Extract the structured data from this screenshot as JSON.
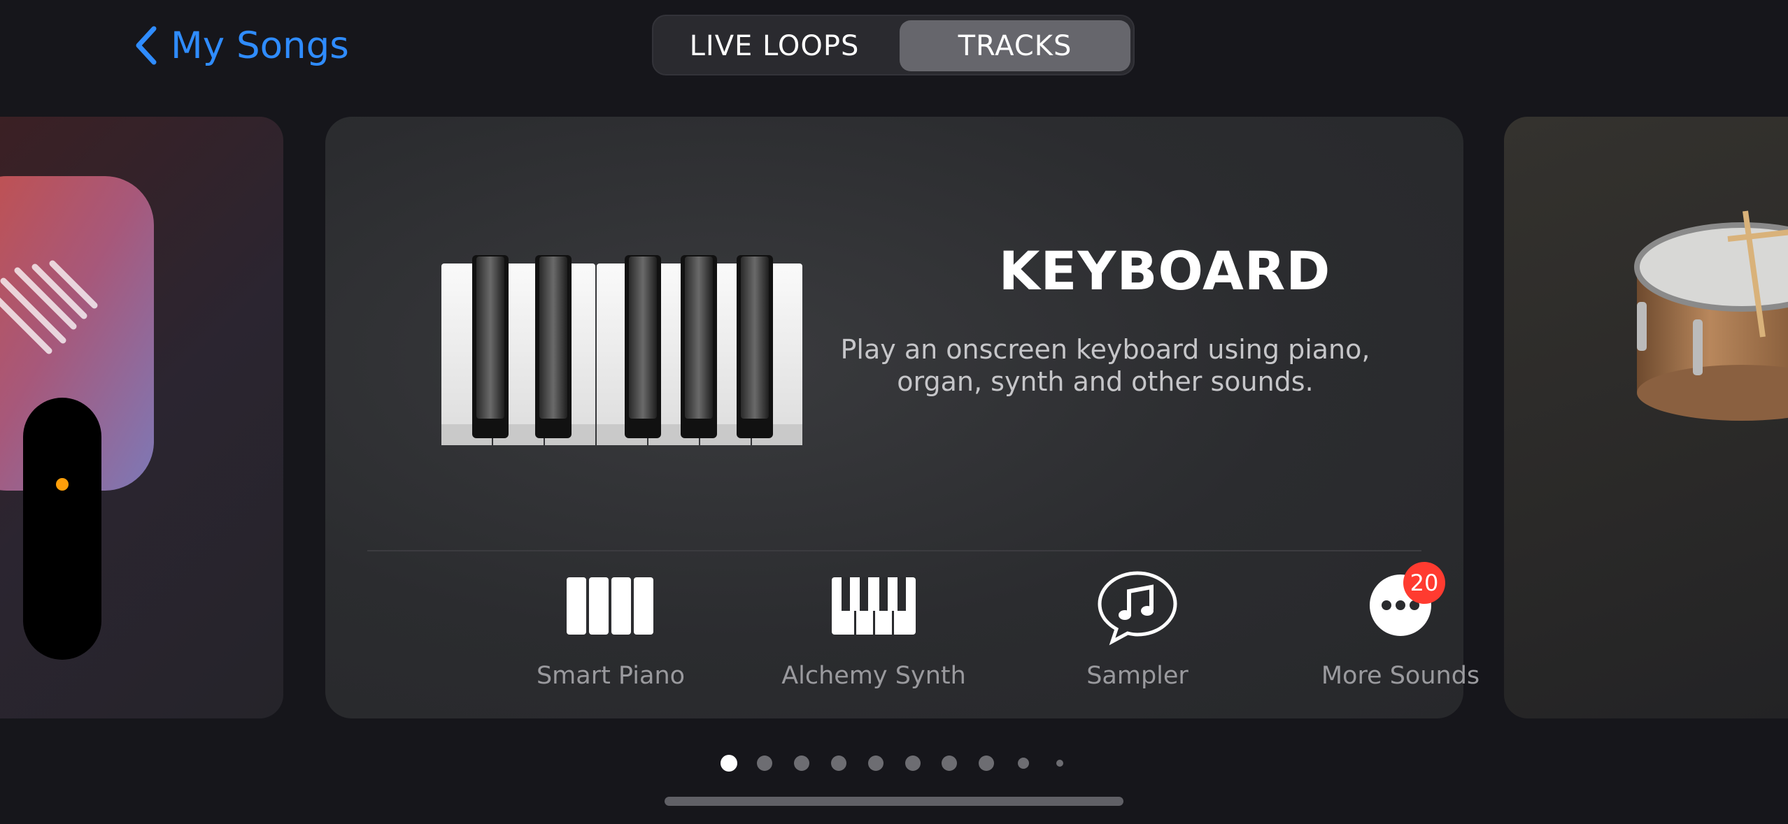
{
  "nav": {
    "back_label": "My Songs"
  },
  "segmented_control": {
    "segments": [
      {
        "label": "LIVE LOOPS",
        "selected": false
      },
      {
        "label": "TRACKS",
        "selected": true
      }
    ]
  },
  "main_card": {
    "title": "KEYBOARD",
    "description": "Play an onscreen keyboard using piano, organ, synth and other sounds.",
    "instruments": [
      {
        "label": "Smart Piano",
        "icon": "smart-piano-icon"
      },
      {
        "label": "Alchemy Synth",
        "icon": "alchemy-synth-icon"
      },
      {
        "label": "Sampler",
        "icon": "sampler-icon"
      },
      {
        "label": "More Sounds",
        "icon": "more-sounds-icon",
        "badge": "20"
      }
    ]
  },
  "side_cards": {
    "left_icon": "microphone-icon",
    "right_icon": "drum-icon"
  },
  "pager": {
    "total_dots": 10,
    "active_index": 0
  },
  "colors": {
    "accent": "#2f8cff",
    "badge": "#ff3b30",
    "recording_dot": "#ff9f0a",
    "background": "#16161b"
  }
}
